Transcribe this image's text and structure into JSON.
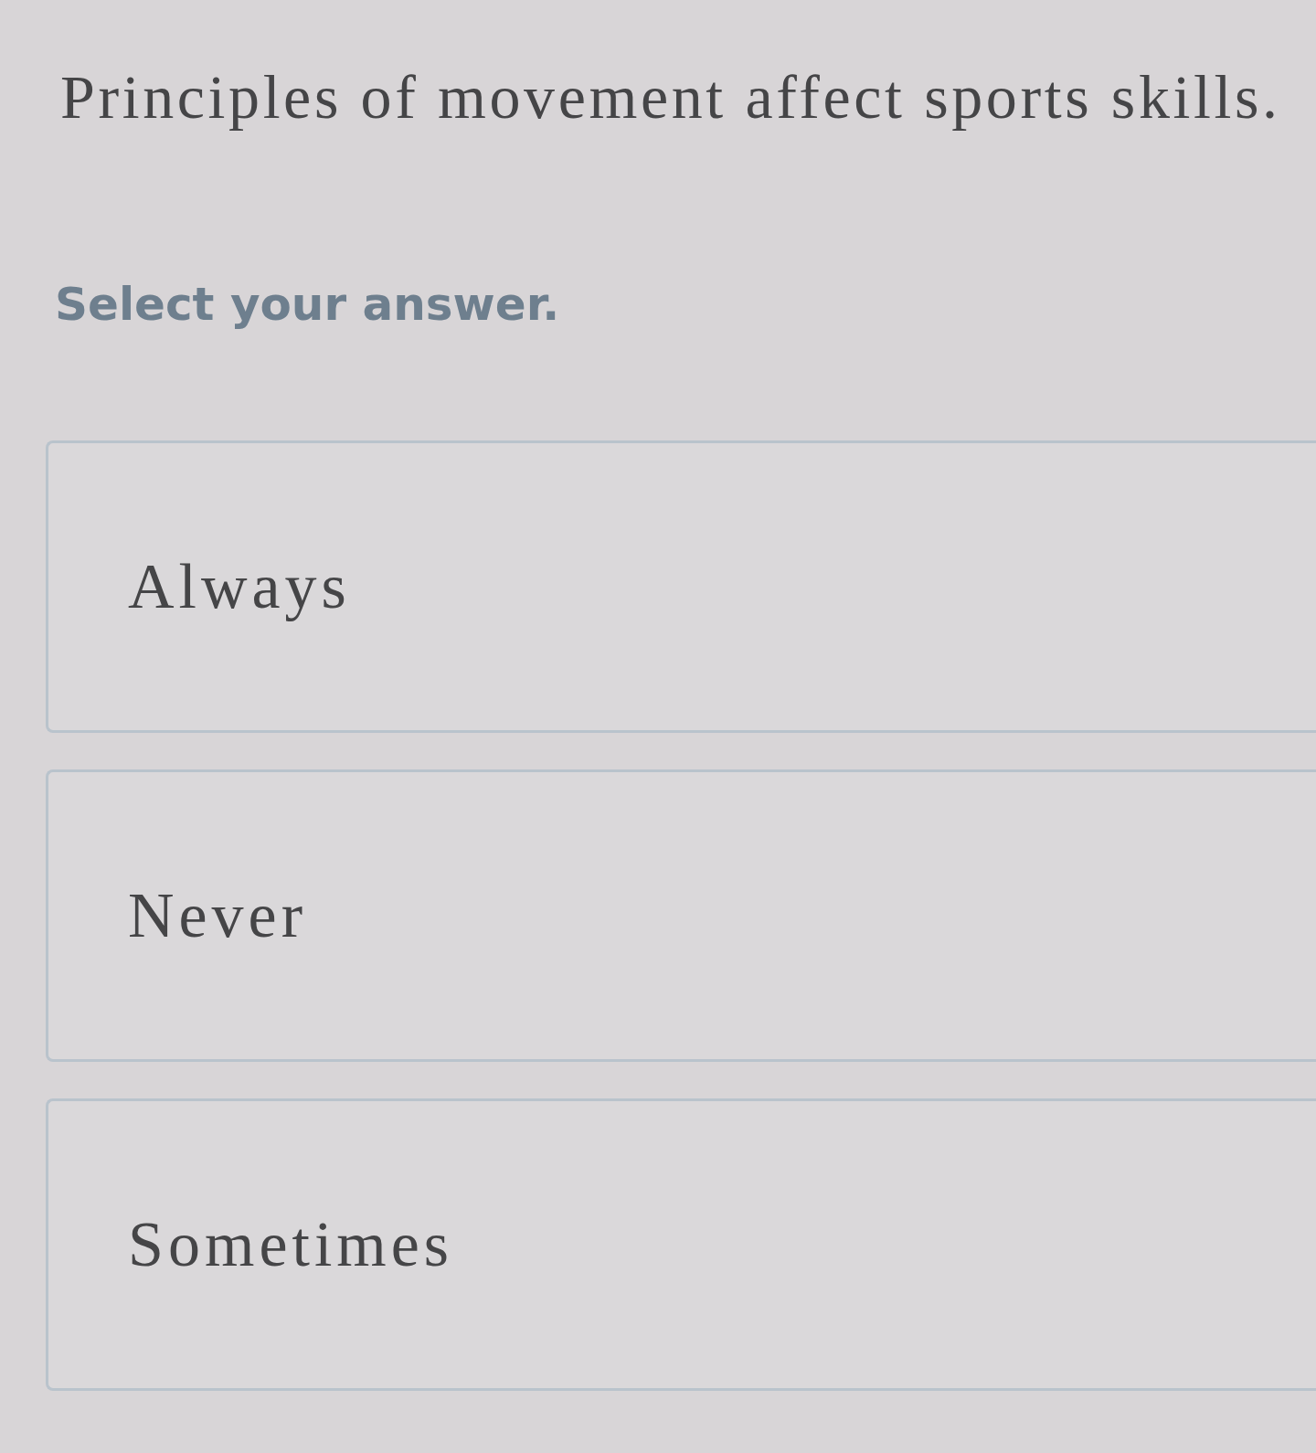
{
  "question": "Principles of movement affect sports skills.",
  "instruction": "Select your answer.",
  "options": [
    {
      "label": "Always",
      "selected": false
    },
    {
      "label": "Never",
      "selected": false
    },
    {
      "label": "Sometimes",
      "selected": false
    }
  ]
}
